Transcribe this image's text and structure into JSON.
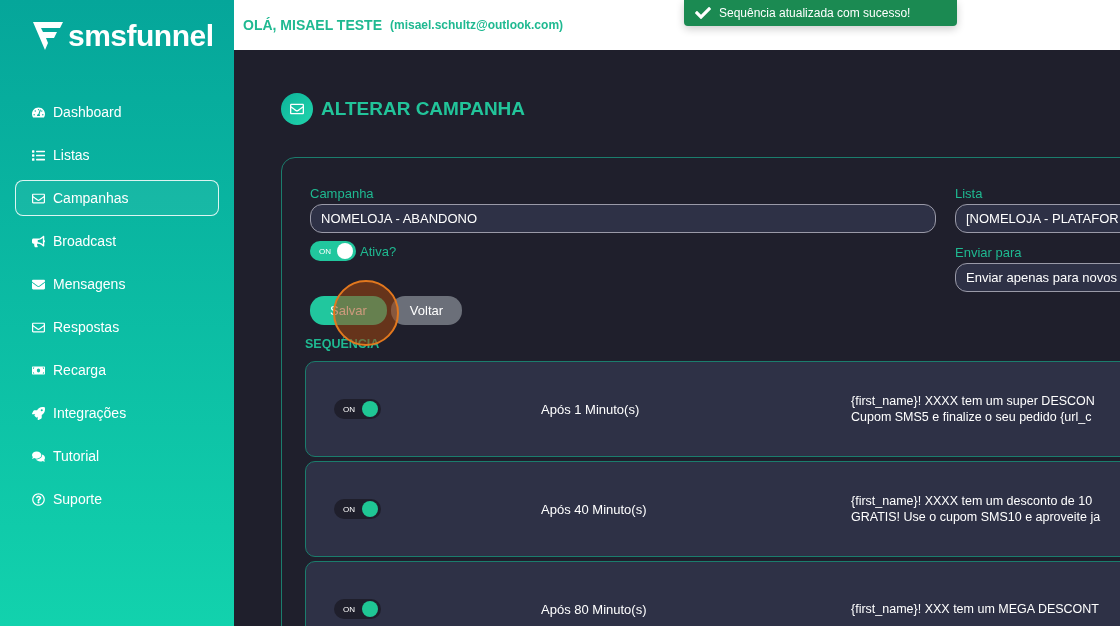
{
  "logo": {
    "text": "smsfunnel"
  },
  "header": {
    "greeting": "OLÁ, MISAEL TESTE",
    "email": "(misael.schultz@outlook.com)"
  },
  "toast": {
    "message": "Sequência atualizada com sucesso!"
  },
  "sidebar": {
    "items": [
      {
        "label": "Dashboard",
        "selected": false
      },
      {
        "label": "Listas",
        "selected": false
      },
      {
        "label": "Campanhas",
        "selected": true
      },
      {
        "label": "Broadcast",
        "selected": false
      },
      {
        "label": "Mensagens",
        "selected": false
      },
      {
        "label": "Respostas",
        "selected": false
      },
      {
        "label": "Recarga",
        "selected": false
      },
      {
        "label": "Integrações",
        "selected": false
      },
      {
        "label": "Tutorial",
        "selected": false
      },
      {
        "label": "Suporte",
        "selected": false
      }
    ]
  },
  "page": {
    "title": "ALTERAR CAMPANHA"
  },
  "form": {
    "campaign": {
      "label": "Campanha",
      "value": "NOMELOJA - ABANDONO"
    },
    "active": {
      "label": "Ativa?",
      "toggle_text": "ON",
      "on": true
    },
    "list": {
      "label": "Lista",
      "value": "[NOMELOJA - PLATAFOR"
    },
    "send_to": {
      "label": "Enviar para",
      "value": "Enviar apenas para novos"
    },
    "buttons": [
      {
        "label": "Salvar",
        "kind": "primary"
      },
      {
        "label": "Voltar",
        "kind": "secondary"
      }
    ]
  },
  "sequence": {
    "title": "SEQUÊNCIA",
    "steps": [
      {
        "on": true,
        "toggle_text": "ON",
        "delay": "Após 1 Minuto(s)",
        "message_lines": [
          "{first_name}! XXXX tem um super DESCON",
          "Cupom SMS5 e finalize o seu pedido {url_c"
        ]
      },
      {
        "on": true,
        "toggle_text": "ON",
        "delay": "Após 40 Minuto(s)",
        "message_lines": [
          "{first_name}! XXXX tem um desconto de 10",
          "GRATIS! Use o cupom SMS10 e aproveite ja"
        ]
      },
      {
        "on": true,
        "toggle_text": "ON",
        "delay": "Após 80 Minuto(s)",
        "message_lines": [
          "{first_name}! XXX tem um MEGA DESCONT"
        ]
      }
    ]
  }
}
